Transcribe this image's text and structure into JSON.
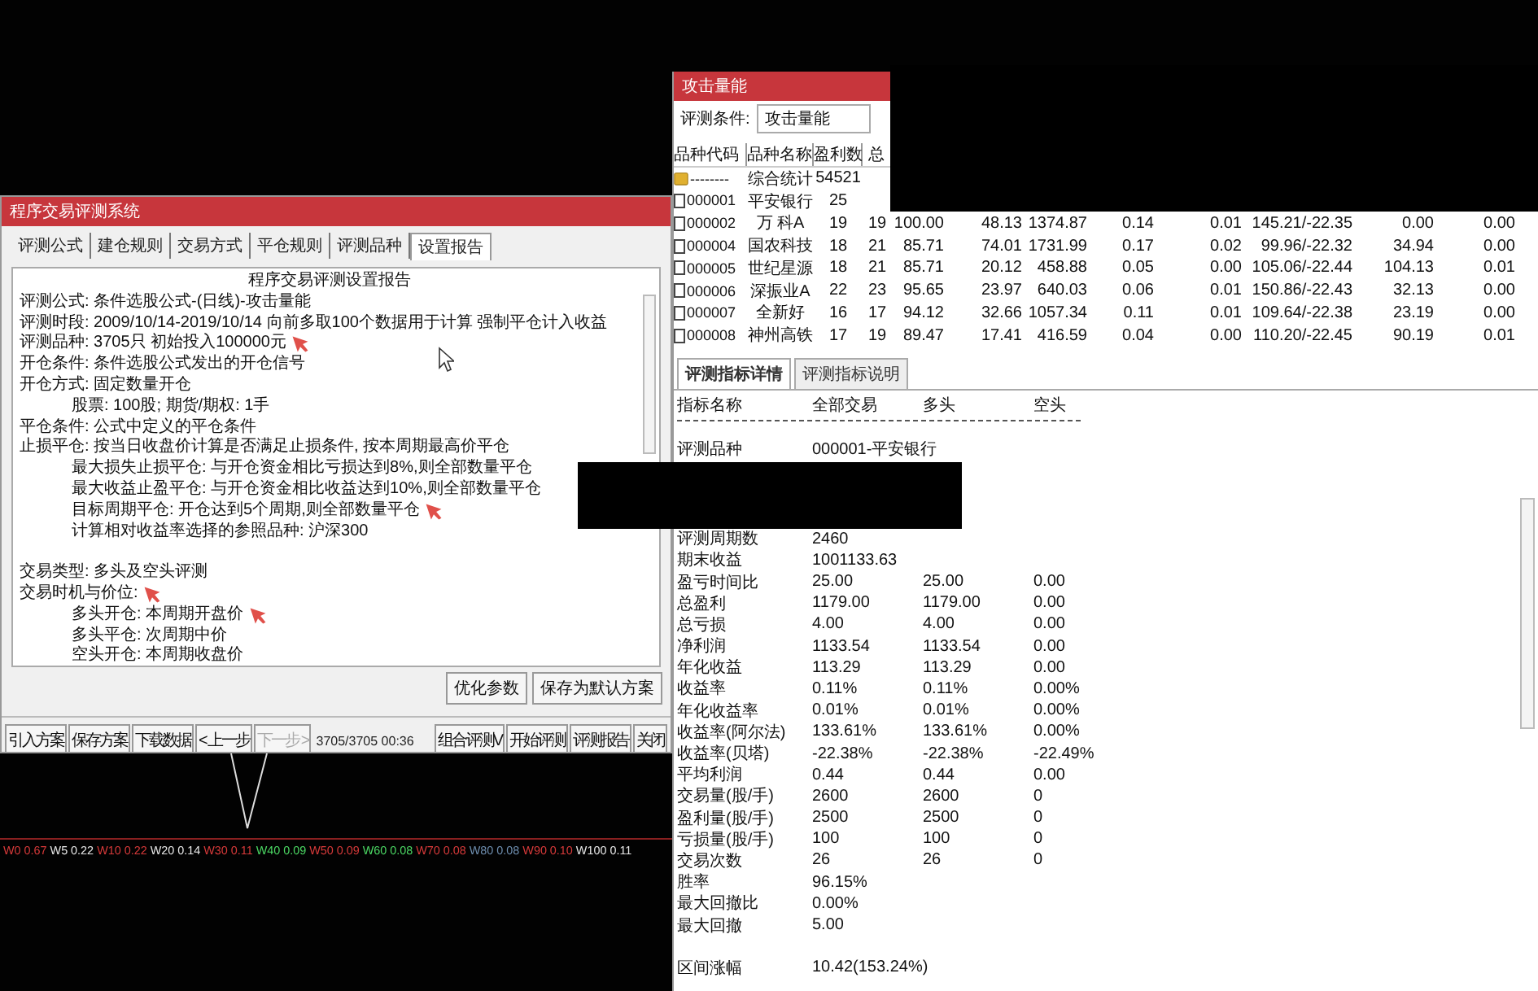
{
  "left_window": {
    "title": "程序交易评测系统",
    "tabs": [
      {
        "label": "评测公式",
        "selected": false
      },
      {
        "label": "建仓规则",
        "selected": false
      },
      {
        "label": "交易方式",
        "selected": false
      },
      {
        "label": "平仓规则",
        "selected": false
      },
      {
        "label": "评测品种",
        "selected": false
      },
      {
        "label": "设置报告",
        "selected": true
      }
    ],
    "report": {
      "heading": "程序交易评测设置报告",
      "lines": [
        {
          "kind": "line",
          "text": "评测公式: 条件选股公式-(日线)-攻击量能",
          "annotated": false
        },
        {
          "kind": "line",
          "text": "评测时段: 2009/10/14-2019/10/14 向前多取100个数据用于计算 强制平仓计入收益",
          "annotated": false
        },
        {
          "kind": "line",
          "text": "评测品种: 3705只 初始投入100000元",
          "annotated": true
        },
        {
          "kind": "line",
          "text": "开仓条件: 条件选股公式发出的开仓信号",
          "annotated": false
        },
        {
          "kind": "line",
          "text": "开仓方式: 固定数量开仓",
          "annotated": false
        },
        {
          "kind": "indented",
          "text": "股票: 100股; 期货/期权: 1手",
          "annotated": false
        },
        {
          "kind": "line",
          "text": "平仓条件: 公式中定义的平仓条件",
          "annotated": false
        },
        {
          "kind": "line",
          "text": "止损平仓: 按当日收盘价计算是否满足止损条件, 按本周期最高价平仓",
          "annotated": false
        },
        {
          "kind": "indented",
          "text": "最大损失止损平仓: 与开仓资金相比亏损达到8%,则全部数量平仓",
          "annotated": false
        },
        {
          "kind": "indented",
          "text": "最大收益止盈平仓: 与开仓资金相比收益达到10%,则全部数量平仓",
          "annotated": false
        },
        {
          "kind": "indented",
          "text": "目标周期平仓: 开仓达到5个周期,则全部数量平仓",
          "annotated": true
        },
        {
          "kind": "indented",
          "text": "计算相对收益率选择的参照品种: 沪深300",
          "annotated": false
        },
        {
          "kind": "section",
          "text": "交易类型: 多头及空头评测",
          "annotated": false
        },
        {
          "kind": "line",
          "text": "交易时机与价位:",
          "annotated": true
        },
        {
          "kind": "indented",
          "text": "多头开仓: 本周期开盘价",
          "annotated": true
        },
        {
          "kind": "indented",
          "text": "多头平仓: 次周期中价",
          "annotated": false
        },
        {
          "kind": "indented",
          "text": "空头开仓: 本周期收盘价",
          "annotated": false
        }
      ]
    },
    "actions": [
      "优化参数",
      "保存为默认方案"
    ],
    "toolbar": [
      {
        "label": "引入方案",
        "disabled": false
      },
      {
        "label": "保存方案",
        "disabled": false
      },
      {
        "label": "下载数据",
        "disabled": false
      },
      {
        "label": "< 上一步",
        "disabled": false
      },
      {
        "label": "下一步 >",
        "disabled": true
      }
    ],
    "progress": "3705/3705 00:36",
    "toolbar_right": [
      {
        "label": "组合评测V",
        "disabled": false
      },
      {
        "label": "开始评测",
        "disabled": false
      },
      {
        "label": "评测报告",
        "disabled": false
      },
      {
        "label": "关闭",
        "disabled": false
      }
    ]
  },
  "indicator_bar": [
    {
      "label": "W0 0.67",
      "color": "#d83a3a"
    },
    {
      "label": "W5 0.22",
      "color": "#e8e8e8"
    },
    {
      "label": "W10 0.22",
      "color": "#d83a3a"
    },
    {
      "label": "W20 0.14",
      "color": "#e8e8e8"
    },
    {
      "label": "W30 0.11",
      "color": "#d83a3a"
    },
    {
      "label": "W40 0.09",
      "color": "#4cd964"
    },
    {
      "label": "W50 0.09",
      "color": "#d83a3a"
    },
    {
      "label": "W60 0.08",
      "color": "#4cd964"
    },
    {
      "label": "W70 0.08",
      "color": "#d83a3a"
    },
    {
      "label": "W80 0.08",
      "color": "#6f8fb0"
    },
    {
      "label": "W90 0.10",
      "color": "#d83a3a"
    },
    {
      "label": "W100 0.11",
      "color": "#e8e8e8"
    }
  ],
  "right_window": {
    "title": "攻击量能",
    "condition": {
      "label": "评测条件:",
      "value": "攻击量能"
    },
    "table": {
      "columns": [
        "品种代码",
        "品种名称",
        "盈利数",
        "总"
      ],
      "rows": [
        {
          "kind": "summary",
          "cells": [
            "--------",
            "综合统计",
            "54521"
          ]
        },
        {
          "kind": "stock",
          "checked": false,
          "cells": [
            "000001",
            "平安银行",
            "25"
          ]
        },
        {
          "kind": "stock",
          "checked": false,
          "cells": [
            "000002",
            "万 科A",
            "19",
            "19",
            "100.00",
            "48.13",
            "1374.87",
            "0.14",
            "0.01",
            "145.21/-22.35",
            "0.00",
            "0.00"
          ]
        },
        {
          "kind": "stock",
          "checked": false,
          "cells": [
            "000004",
            "国农科技",
            "18",
            "21",
            "85.71",
            "74.01",
            "1731.99",
            "0.17",
            "0.02",
            "99.96/-22.32",
            "34.94",
            "0.00"
          ]
        },
        {
          "kind": "stock",
          "checked": false,
          "cells": [
            "000005",
            "世纪星源",
            "18",
            "21",
            "85.71",
            "20.12",
            "458.88",
            "0.05",
            "0.00",
            "105.06/-22.44",
            "104.13",
            "0.01"
          ]
        },
        {
          "kind": "stock",
          "checked": false,
          "cells": [
            "000006",
            "深振业A",
            "22",
            "23",
            "95.65",
            "23.97",
            "640.03",
            "0.06",
            "0.01",
            "150.86/-22.43",
            "32.13",
            "0.00"
          ]
        },
        {
          "kind": "stock",
          "checked": false,
          "cells": [
            "000007",
            "全新好",
            "16",
            "17",
            "94.12",
            "32.66",
            "1057.34",
            "0.11",
            "0.01",
            "109.64/-22.38",
            "23.19",
            "0.00"
          ]
        },
        {
          "kind": "stock",
          "checked": false,
          "cells": [
            "000008",
            "神州高铁",
            "17",
            "19",
            "89.47",
            "17.41",
            "416.59",
            "0.04",
            "0.00",
            "110.20/-22.45",
            "90.19",
            "0.01"
          ]
        }
      ]
    },
    "tabs": [
      {
        "label": "评测指标详情",
        "selected": true
      },
      {
        "label": "评测指标说明",
        "selected": false
      }
    ],
    "detail": {
      "columns": [
        "指标名称",
        "全部交易",
        "多头",
        "空头"
      ],
      "sample": [
        "评测品种",
        "000001-平安银行"
      ],
      "rows": [
        {
          "cells": [
            "评测周期数",
            "2460"
          ]
        },
        {
          "cells": [
            "期末收益",
            "1001133.63"
          ]
        },
        {
          "cells": [
            "盈亏时间比",
            "25.00",
            "25.00",
            "0.00"
          ]
        },
        {
          "cells": [
            "总盈利",
            "1179.00",
            "1179.00",
            "0.00"
          ]
        },
        {
          "cells": [
            "总亏损",
            "4.00",
            "4.00",
            "0.00"
          ]
        },
        {
          "cells": [
            "净利润",
            "1133.54",
            "1133.54",
            "0.00"
          ]
        },
        {
          "cells": [
            "年化收益",
            "113.29",
            "113.29",
            "0.00"
          ]
        },
        {
          "cells": [
            "收益率",
            "0.11%",
            "0.11%",
            "0.00%"
          ]
        },
        {
          "cells": [
            "年化收益率",
            "0.01%",
            "0.01%",
            "0.00%"
          ]
        },
        {
          "cells": [
            "收益率(阿尔法)",
            "133.61%",
            "133.61%",
            "0.00%"
          ]
        },
        {
          "cells": [
            "收益率(贝塔)",
            "-22.38%",
            "-22.38%",
            "-22.49%"
          ]
        },
        {
          "cells": [
            "平均利润",
            "0.44",
            "0.44",
            "0.00"
          ]
        },
        {
          "cells": [
            "交易量(股/手)",
            "2600",
            "2600",
            "0"
          ]
        },
        {
          "cells": [
            "盈利量(股/手)",
            "2500",
            "2500",
            "0"
          ]
        },
        {
          "cells": [
            "亏损量(股/手)",
            "100",
            "100",
            "0"
          ]
        },
        {
          "cells": [
            "交易次数",
            "26",
            "26",
            "0"
          ]
        },
        {
          "cells": [
            "胜率",
            "96.15%"
          ]
        },
        {
          "cells": [
            "最大回撤比",
            "0.00%"
          ]
        },
        {
          "cells": [
            "最大回撤",
            "5.00"
          ]
        }
      ],
      "range": [
        "区间涨幅",
        "10.42(153.24%)"
      ]
    }
  }
}
